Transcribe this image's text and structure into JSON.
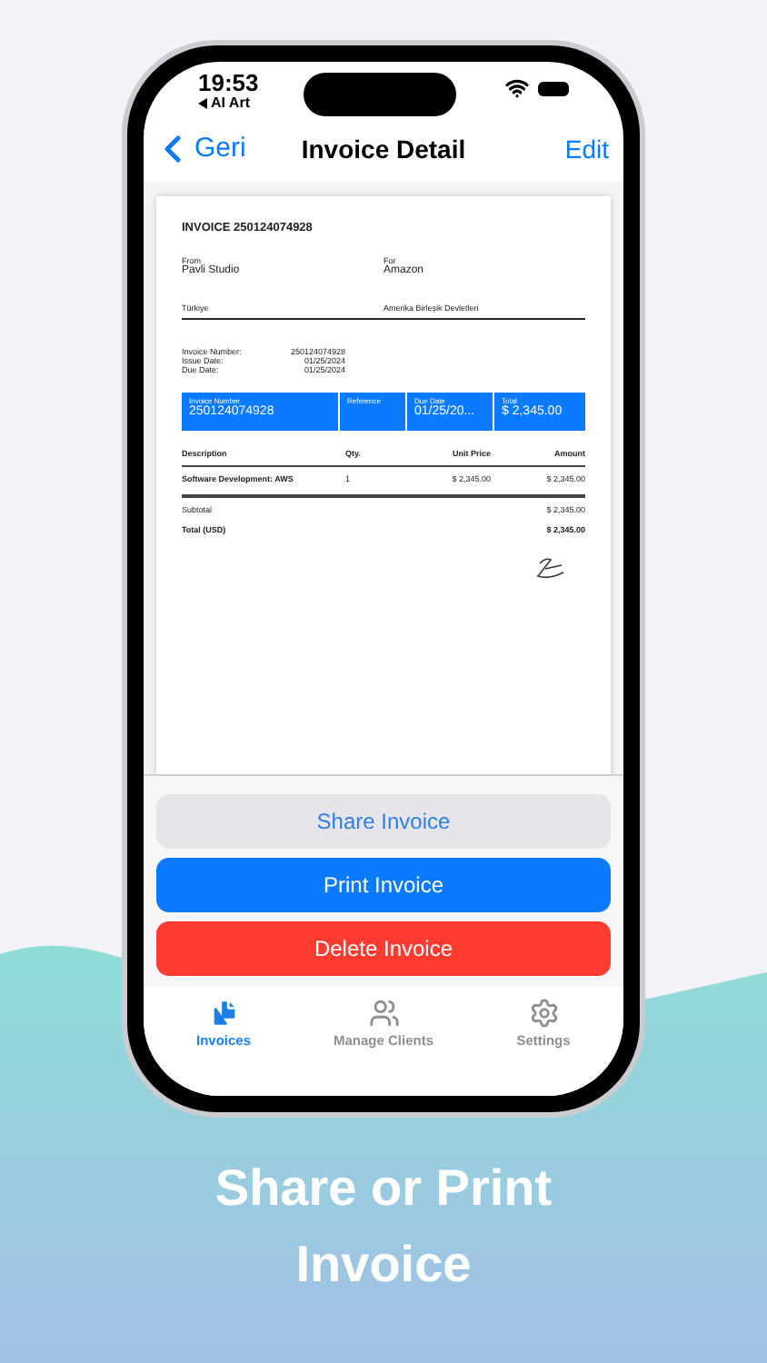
{
  "status_bar": {
    "time": "19:53",
    "back_app": "AI Art"
  },
  "nav": {
    "back": "Geri",
    "title": "Invoice Detail",
    "action": "Edit"
  },
  "invoice": {
    "title": "INVOICE 250124074928",
    "from_label": "From",
    "from_name": "Pavli Studio",
    "for_label": "For",
    "for_name": "Amazon",
    "from_country": "Türkiye",
    "for_country": "Amerika Birleşik Devletleri",
    "meta": [
      {
        "label": "Invoice Number:",
        "value": "250124074928"
      },
      {
        "label": "Issue Date:",
        "value": "01/25/2024"
      },
      {
        "label": "Due Date:",
        "value": "01/25/2024"
      }
    ],
    "summary": [
      {
        "label": "Invoice Number",
        "value": "250124074928"
      },
      {
        "label": "Reference"
      },
      {
        "label": "Due Date",
        "value": "01/25/20..."
      },
      {
        "label": "Total",
        "value": "$ 2,345.00"
      }
    ],
    "columns": [
      "Description",
      "Qty.",
      "Unit Price",
      "Amount"
    ],
    "rows": [
      [
        "Software Development: AWS",
        "1",
        "$ 2,345.00",
        "$ 2,345.00"
      ]
    ],
    "totals": [
      {
        "label": "Subtotal",
        "value": "$ 2,345.00"
      },
      {
        "label": "Total (USD)",
        "value": "$ 2,345.00"
      }
    ]
  },
  "buttons": [
    {
      "label": "Share Invoice",
      "kind": "secondary"
    },
    {
      "label": "Print Invoice",
      "kind": "primary"
    },
    {
      "label": "Delete Invoice",
      "kind": "destructive"
    }
  ],
  "tabs": [
    {
      "label": "Invoices",
      "selected": true
    },
    {
      "label": "Manage Clients",
      "selected": false
    },
    {
      "label": "Settings",
      "selected": false
    }
  ],
  "caption": "Share or Print Invoice"
}
